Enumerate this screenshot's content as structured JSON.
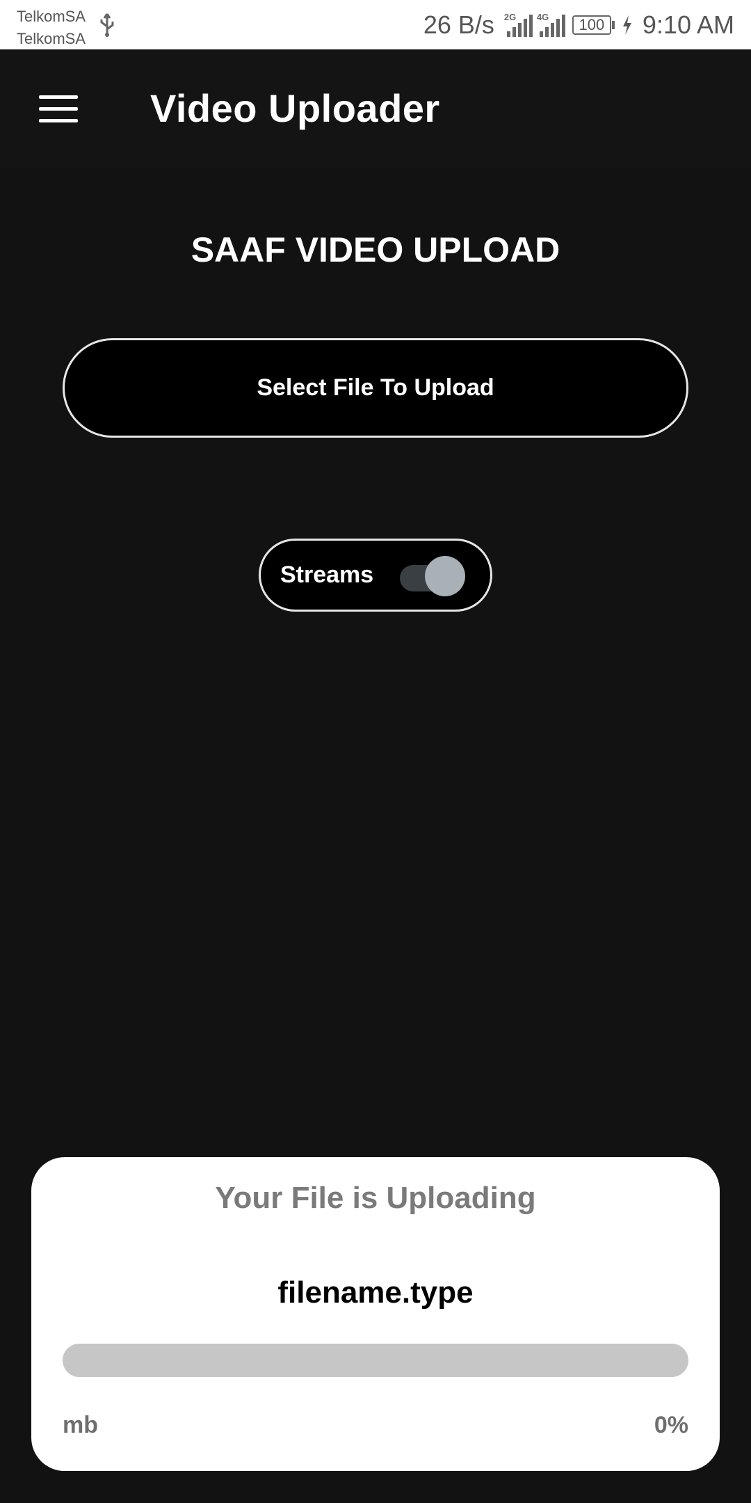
{
  "status_bar": {
    "carrier_1": "TelkomSA",
    "carrier_2": "TelkomSA",
    "net_speed": "26 B/s",
    "signal_1_label": "2G",
    "signal_2_label": "4G",
    "battery": "100",
    "time": "9:10 AM",
    "icons": [
      "usb-icon",
      "signal-icon",
      "signal-icon",
      "battery-icon",
      "charging-icon"
    ]
  },
  "app_bar": {
    "title": "Video Uploader",
    "menu_icon": "hamburger-menu-icon"
  },
  "main": {
    "heading": "SAAF VIDEO UPLOAD",
    "select_button_label": "Select File To Upload",
    "streams_label": "Streams",
    "streams_enabled": true
  },
  "upload_card": {
    "title": "Your File is Uploading",
    "file_name": "filename.type",
    "size_unit": "mb",
    "percent_label": "0%",
    "progress": 0
  },
  "colors": {
    "background": "#121212",
    "card": "#ffffff",
    "progress_track": "#c6c6c6",
    "switch_thumb": "#a8b1b8"
  }
}
